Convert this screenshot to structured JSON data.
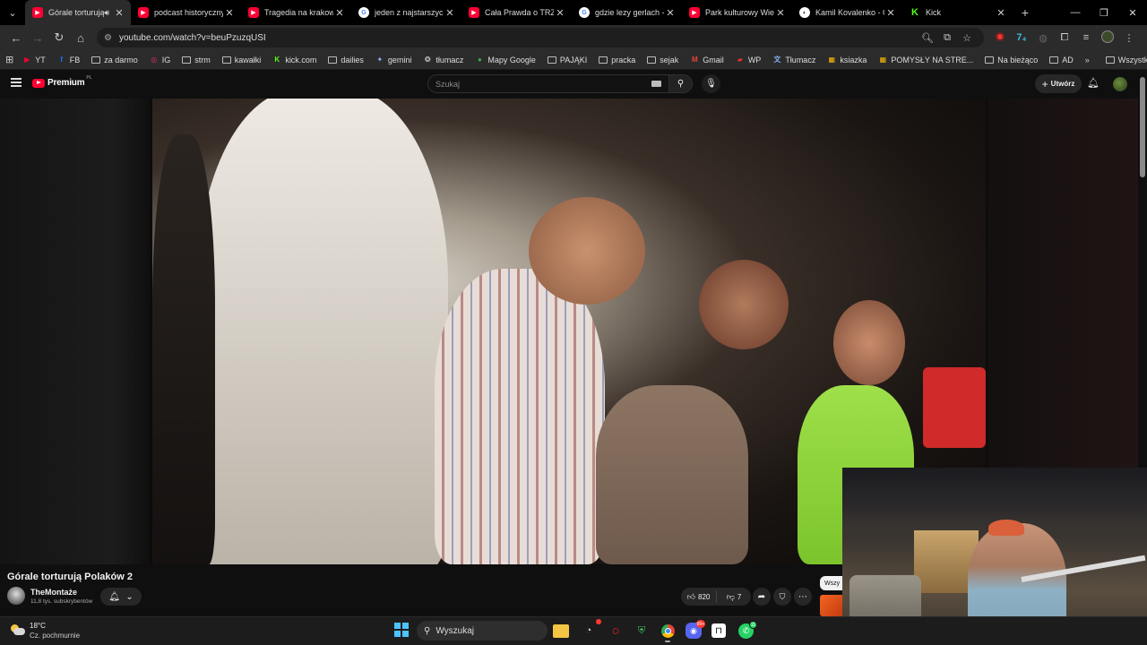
{
  "tabs": [
    {
      "title": "Górale torturują P",
      "favicon": "youtube-icon",
      "active": true,
      "audio": true
    },
    {
      "title": "podcast historyczny p",
      "favicon": "youtube-icon"
    },
    {
      "title": "Tragedia na krakowsk",
      "favicon": "youtube-icon"
    },
    {
      "title": "jeden z najstarszych c",
      "favicon": "google-icon"
    },
    {
      "title": "Cała Prawda o TRZEZ",
      "favicon": "youtube-icon"
    },
    {
      "title": "gdzie lezy gerlach - S",
      "favicon": "google-icon"
    },
    {
      "title": "Park kulturowy Wietr",
      "favicon": "youtube-icon"
    },
    {
      "title": "Kamil Kovalenko - Co",
      "favicon": "copilot-icon"
    },
    {
      "title": "Kick",
      "favicon": "kick-icon"
    }
  ],
  "address_bar": {
    "url": "youtube.com/watch?v=beuPzuzqUSI"
  },
  "bookmarks": [
    {
      "label": "YT",
      "icon": "youtube-icon"
    },
    {
      "label": "FB",
      "icon": "facebook-icon"
    },
    {
      "label": "za darmo",
      "icon": "folder-icon"
    },
    {
      "label": "IG",
      "icon": "instagram-icon"
    },
    {
      "label": "strm",
      "icon": "folder-icon"
    },
    {
      "label": "kawałki",
      "icon": "folder-icon"
    },
    {
      "label": "kick.com",
      "icon": "kick-icon"
    },
    {
      "label": "dailies",
      "icon": "folder-icon"
    },
    {
      "label": "gemini",
      "icon": "gemini-icon"
    },
    {
      "label": "tłumacz",
      "icon": "chatgpt-icon"
    },
    {
      "label": "Mapy Google",
      "icon": "maps-pin-icon"
    },
    {
      "label": "PAJĄKI",
      "icon": "folder-icon"
    },
    {
      "label": "pracka",
      "icon": "folder-icon"
    },
    {
      "label": "sejak",
      "icon": "folder-icon"
    },
    {
      "label": "Gmail",
      "icon": "gmail-icon"
    },
    {
      "label": "WP",
      "icon": "wp-icon"
    },
    {
      "label": "Tłumacz",
      "icon": "translate-icon"
    },
    {
      "label": "ksiazka",
      "icon": "grid-icon"
    },
    {
      "label": "POMYSŁY NA STRE...",
      "icon": "grid-icon"
    },
    {
      "label": "Na bieżąco",
      "icon": "folder-icon"
    },
    {
      "label": "AD",
      "icon": "folder-icon"
    }
  ],
  "bookmarks_all": "Wszystkie zakładki",
  "youtube": {
    "logo_text": "Premium",
    "logo_region": "PL",
    "search_placeholder": "Szukaj",
    "create_label": "Utwórz"
  },
  "video": {
    "title": "Górale torturują Polaków 2",
    "channel": "TheMontaże",
    "subscribers": "11,8 tys. subskrybentów",
    "likes": "820",
    "dislikes": "7",
    "chip_label": "Wszy"
  },
  "taskbar": {
    "temperature": "18°C",
    "condition": "Cz. pochmurnie",
    "search_label": "Wyszukaj",
    "chrome_badge": "",
    "discord_badge": "99+",
    "whatsapp_badge": "11"
  },
  "colors": {
    "youtube_red": "#ff0033",
    "accent_blue": "#4cc2ff",
    "kick_green": "#53fc18"
  }
}
